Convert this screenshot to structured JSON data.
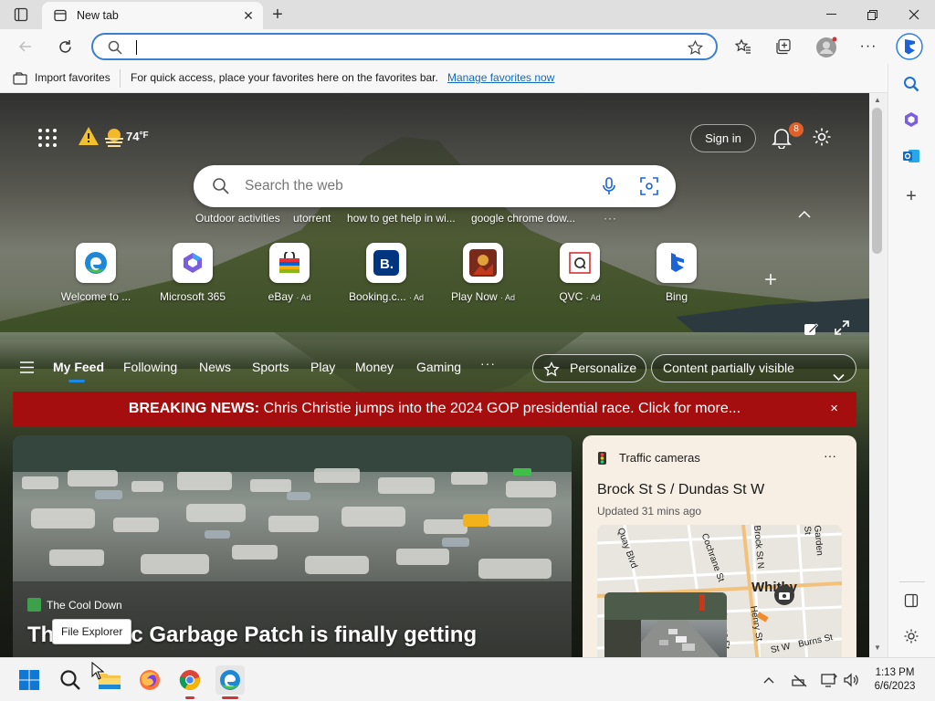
{
  "tab": {
    "title": "New tab"
  },
  "favbar": {
    "import_label": "Import favorites",
    "hint": "For quick access, place your favorites here on the favorites bar.",
    "manage_link": "Manage favorites now"
  },
  "header": {
    "temperature": "74",
    "temp_unit": "°F",
    "sign_in": "Sign in",
    "notification_count": "8"
  },
  "search": {
    "placeholder": "Search the web"
  },
  "trending": [
    "Outdoor activities",
    "utorrent",
    "how to get help in wi...",
    "google chrome dow...",
    "···"
  ],
  "quick_links": [
    {
      "label": "Welcome to ...",
      "ad": ""
    },
    {
      "label": "Microsoft 365",
      "ad": ""
    },
    {
      "label": "eBay",
      "ad": "· Ad"
    },
    {
      "label": "Booking.c...",
      "ad": "· Ad"
    },
    {
      "label": "Play Now",
      "ad": "· Ad"
    },
    {
      "label": "QVC",
      "ad": "· Ad"
    },
    {
      "label": "Bing",
      "ad": ""
    }
  ],
  "feed_nav": {
    "items": [
      "My Feed",
      "Following",
      "News",
      "Sports",
      "Play",
      "Money",
      "Gaming",
      "···"
    ],
    "personalize": "Personalize",
    "content_visibility": "Content partially visible"
  },
  "breaking": {
    "label": "BREAKING NEWS:",
    "text": "Chris Christie jumps into the 2024 GOP presidential race. Click for more...",
    "close": "×"
  },
  "hero": {
    "source": "The Cool Down",
    "headline": "The Pacific Garbage Patch is finally getting"
  },
  "traffic": {
    "header": "Traffic cameras",
    "more": "···",
    "location": "Brock St S / Dundas St W",
    "updated": "Updated 31 mins ago",
    "map_labels": [
      "Quay Blvd",
      "Cochrane St",
      "Brock St N",
      "Garden St",
      "Whitby",
      "Henry St",
      "James St",
      "Burns St",
      "St W"
    ]
  },
  "tooltip": {
    "text": "File Explorer"
  },
  "clock": {
    "time": "1:13 PM",
    "date": "6/6/2023"
  },
  "colors": {
    "accent": "#0f6cbd",
    "breaking_bg": "#a50e0e",
    "omnibox_border": "#3b7fd4"
  }
}
